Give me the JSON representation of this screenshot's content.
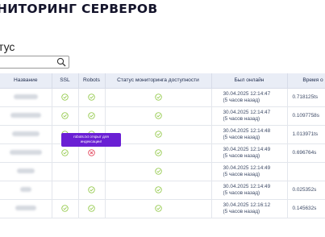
{
  "title": "НИТОРИНГ СЕРВЕРОВ",
  "section": "тус",
  "search": {
    "value": "",
    "placeholder": ""
  },
  "table": {
    "headers": [
      "Название",
      "SSL",
      "Robots",
      "Статус мониторинга доступности",
      "Был онлайн",
      "Время о"
    ],
    "rows": [
      {
        "ssl": "ok",
        "robots": "ok",
        "status": "ok",
        "online_date": "30.04.2025 12:14:47",
        "online_ago": "(5 часов назад)",
        "response": "0.718125ts"
      },
      {
        "ssl": "ok",
        "robots": "ok",
        "status": "ok",
        "online_date": "30.04.2025 12:14:47",
        "online_ago": "(5 часов назад)",
        "response": "0.1097758s"
      },
      {
        "ssl": "ok",
        "robots": "ok",
        "status": "ok",
        "online_date": "30.04.2025 12:14:48",
        "online_ago": "(5 часов назад)",
        "response": "1.013971ts"
      },
      {
        "ssl": "ok",
        "robots": "error",
        "status": "ok",
        "online_date": "30.04.2025 12:14:49",
        "online_ago": "(5 часов назад)",
        "response": "0.696764s"
      },
      {
        "ssl": "",
        "robots": "",
        "status": "ok",
        "online_date": "30.04.2025 12:14:49",
        "online_ago": "(5 часов назад)",
        "response": ""
      },
      {
        "ssl": "",
        "robots": "ok",
        "status": "ok",
        "online_date": "30.04.2025 12:14:49",
        "online_ago": "(5 часов назад)",
        "response": "0.025352s"
      },
      {
        "ssl": "ok",
        "robots": "ok",
        "status": "ok",
        "online_date": "30.04.2025 12:16:12",
        "online_ago": "(5 часов назад)",
        "response": "0.145632s"
      }
    ]
  },
  "tooltip": {
    "line1": "robots.txt открыт для",
    "line2": "индексации!"
  },
  "colors": {
    "ok": "#8dc63f",
    "error": "#e0344c",
    "tooltip": "#6a1fd4",
    "header_bg": "#e9edf6"
  }
}
